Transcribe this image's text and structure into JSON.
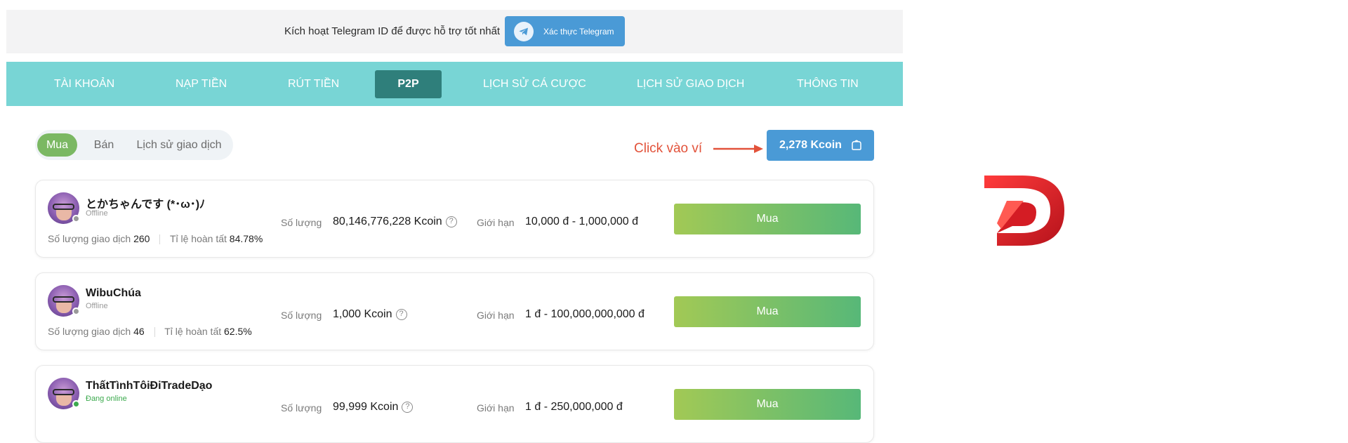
{
  "banner": {
    "text": "Kích hoạt Telegram ID để được hỗ trợ tốt nhất",
    "button_label": "Xác thực Telegram"
  },
  "nav": {
    "items": [
      {
        "label": "TÀI KHOẢN"
      },
      {
        "label": "NẠP TIỀN"
      },
      {
        "label": "RÚT TIỀN"
      },
      {
        "label": "P2P",
        "active": true
      },
      {
        "label": "LỊCH SỬ CÁ CƯỢC"
      },
      {
        "label": "LỊCH SỬ GIAO DỊCH"
      },
      {
        "label": "THÔNG TIN"
      }
    ]
  },
  "tabs": {
    "items": [
      {
        "label": "Mua",
        "active": true
      },
      {
        "label": "Bán"
      },
      {
        "label": "Lịch sử giao dịch"
      }
    ]
  },
  "wallet": {
    "hint": "Click vào ví",
    "balance": "2,278 Kcoin"
  },
  "labels": {
    "trades": "Số lượng giao dịch",
    "completion": "Tỉ lệ hoàn tất",
    "amount": "Số lượng",
    "limit": "Giới hạn",
    "buy": "Mua",
    "help": "?"
  },
  "offers": [
    {
      "name": "とかちゃんです (*･ω･)ﾉ",
      "presence": "Offline",
      "trades": "260",
      "completion": "84.78%",
      "amount": "80,146,776,228 Kcoin",
      "limit": "10,000 đ - 1,000,000 đ"
    },
    {
      "name": "WibuChúa",
      "presence": "Offline",
      "trades": "46",
      "completion": "62.5%",
      "amount": "1,000 Kcoin",
      "limit": "1 đ - 100,000,000,000 đ"
    },
    {
      "name": "ThấtTìnhTôiĐiTradeDạo",
      "presence": "Đang online",
      "online": true,
      "amount": "99,999 Kcoin",
      "limit": "1 đ - 250,000,000 đ"
    }
  ],
  "colors": {
    "nav_bg": "#78d5d5",
    "nav_active": "#2f7f7b",
    "accent_blue": "#4a9ad6",
    "tab_active": "#7bb863",
    "hint_red": "#e2523a",
    "online_green": "#3caa4e",
    "offline_gray": "#9a9a9a"
  },
  "icons": {
    "telegram": "telegram-icon",
    "wallet": "wallet-icon",
    "help": "help-circle-icon",
    "arrow": "arrow-right-icon",
    "logo": "brand-logo"
  }
}
